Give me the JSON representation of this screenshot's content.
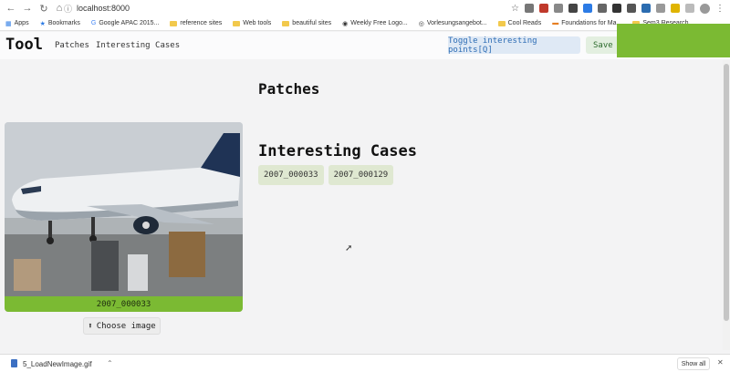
{
  "browser": {
    "url": "localhost:8000",
    "bookmarks": [
      "Apps",
      "Bookmarks",
      "Google APAC 2015...",
      "reference sites",
      "Web tools",
      "beautiful sites",
      "Weekly Free Logo...",
      "Vorlesungsangebot...",
      "Cool Reads",
      "Foundations for Ma...",
      "Sem3 Research"
    ]
  },
  "app": {
    "brand": "Tool",
    "nav": {
      "patches": "Patches",
      "interesting": "Interesting Cases"
    },
    "toggle_label": "Toggle interesting points[Q]",
    "save_label": "Save",
    "accent": "#7bba33"
  },
  "main": {
    "patches_heading": "Patches",
    "cases_heading": "Interesting Cases",
    "cases": [
      "2007_000033",
      "2007_000129"
    ],
    "image_caption": "2007_000033",
    "choose_label": "Choose image"
  },
  "downloads": {
    "file": "5_LoadNewImage.gif",
    "show_all": "Show all"
  }
}
